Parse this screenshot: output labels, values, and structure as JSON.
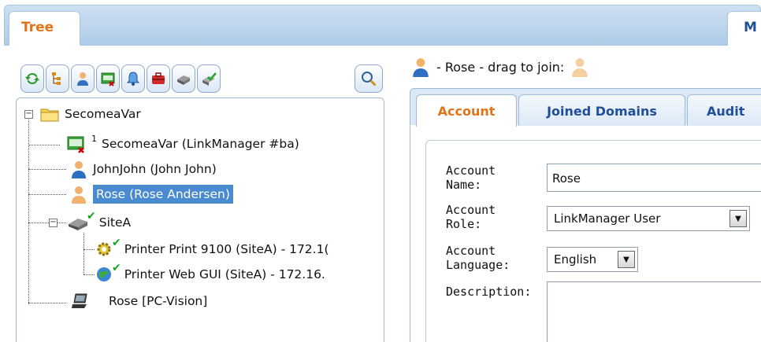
{
  "top_tabs": {
    "tree": "Tree",
    "second": "M"
  },
  "toolbar": {
    "buttons": [
      "refresh-icon",
      "tree-view-icon",
      "user-icon",
      "appliance-icon",
      "bell-icon",
      "toolbox-icon",
      "device-icon",
      "approve-icon"
    ],
    "search": "search-icon"
  },
  "tree": {
    "root": {
      "label": "SecomeaVar",
      "icon": "folder-icon"
    },
    "items": [
      {
        "label": "SecomeaVar (LinkManager #ba)",
        "superscript": "1",
        "icon": "linkmanager-icon"
      },
      {
        "label": "JohnJohn (John John)",
        "icon": "user-icon"
      },
      {
        "label": "Rose (Rose Andersen)",
        "icon": "user-icon",
        "selected": true
      },
      {
        "label": "SiteA",
        "icon": "gateway-icon",
        "check": "✔"
      },
      {
        "label": "Printer Print 9100 (SiteA) - 172.1(",
        "icon": "gear-icon",
        "check": "✔"
      },
      {
        "label": "Printer Web GUI (SiteA) - 172.16.",
        "icon": "web-icon",
        "check": "✔"
      },
      {
        "label": "Rose [PC-Vision]",
        "icon": "laptop-icon"
      }
    ]
  },
  "header": {
    "text": "- Rose - drag to join:"
  },
  "subtabs": [
    "Account",
    "Joined Domains",
    "Audit"
  ],
  "form": {
    "account_name_label": "Account\nName:",
    "account_name_value": "Rose",
    "account_role_label": "Account\nRole:",
    "account_role_value": "LinkManager User",
    "account_language_label": "Account\nLanguage:",
    "account_language_value": "English",
    "description_label": "Description:"
  },
  "colors": {
    "accent_orange": "#e27418",
    "link_blue": "#1f4f9a",
    "selection": "#4a8bd0",
    "check_green": "#19a31a"
  }
}
